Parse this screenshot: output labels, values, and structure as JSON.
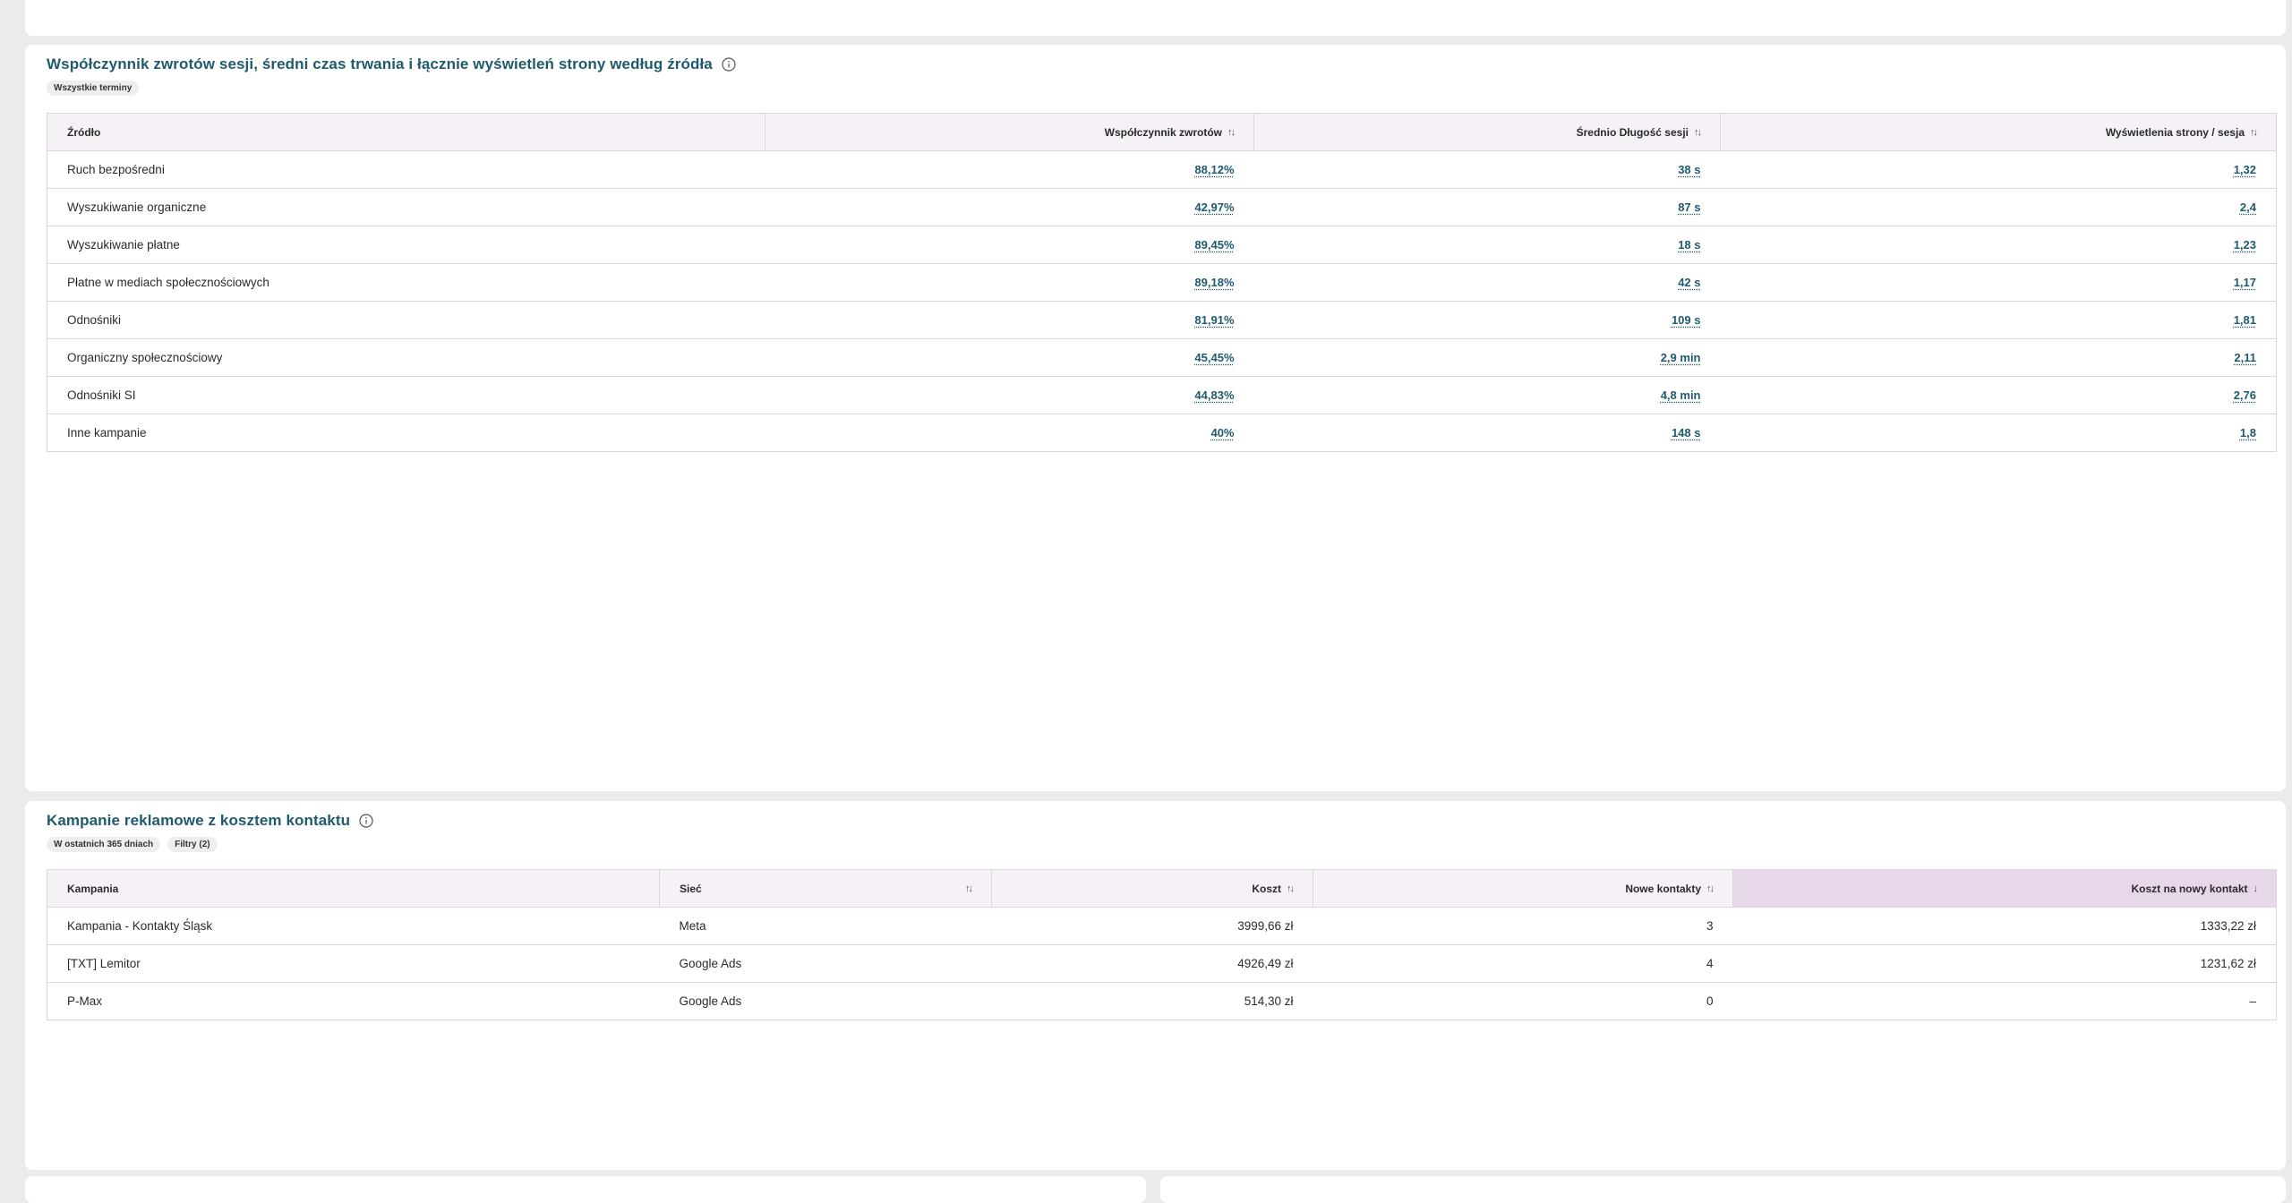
{
  "table1": {
    "title": "Współczynnik zwrotów sesji, średni czas trwania i łącznie wyświetleń strony według źródła",
    "chips": [
      "Wszystkie terminy"
    ],
    "columns": [
      "Źródło",
      "Współczynnik zwrotów",
      "Średnio Długość sesji",
      "Wyświetlenia strony / sesja"
    ],
    "sort_icon": "↑↓",
    "rows": [
      {
        "source": "Ruch bezpośredni",
        "bounce": "88,12%",
        "duration": "38 s",
        "views": "1,32"
      },
      {
        "source": "Wyszukiwanie organiczne",
        "bounce": "42,97%",
        "duration": "87 s",
        "views": "2,4"
      },
      {
        "source": "Wyszukiwanie płatne",
        "bounce": "89,45%",
        "duration": "18 s",
        "views": "1,23"
      },
      {
        "source": "Płatne w mediach społecznościowych",
        "bounce": "89,18%",
        "duration": "42 s",
        "views": "1,17"
      },
      {
        "source": "Odnośniki",
        "bounce": "81,91%",
        "duration": "109 s",
        "views": "1,81"
      },
      {
        "source": "Organiczny społecznościowy",
        "bounce": "45,45%",
        "duration": "2,9 min",
        "views": "2,11"
      },
      {
        "source": "Odnośniki SI",
        "bounce": "44,83%",
        "duration": "4,8 min",
        "views": "2,76"
      },
      {
        "source": "Inne kampanie",
        "bounce": "40%",
        "duration": "148 s",
        "views": "1,8"
      }
    ]
  },
  "table2": {
    "title": "Kampanie reklamowe z kosztem kontaktu",
    "chips": [
      "W ostatnich 365 dniach",
      "Filtry (2)"
    ],
    "columns": [
      "Kampania",
      "Sieć",
      "Koszt",
      "Nowe kontakty",
      "Koszt na nowy kontakt"
    ],
    "sort_icon": "↑↓",
    "sort_desc_icon": "↓",
    "rows": [
      {
        "campaign": "Kampania - Kontakty Śląsk",
        "network": "Meta",
        "cost": "3999,66 zł",
        "contacts": "3",
        "cpc": "1333,22 zł"
      },
      {
        "campaign": "[TXT] Lemitor",
        "network": "Google Ads",
        "cost": "4926,49 zł",
        "contacts": "4",
        "cpc": "1231,62 zł"
      },
      {
        "campaign": "P-Max",
        "network": "Google Ads",
        "cost": "514,30 zł",
        "contacts": "0",
        "cpc": "–"
      }
    ]
  }
}
